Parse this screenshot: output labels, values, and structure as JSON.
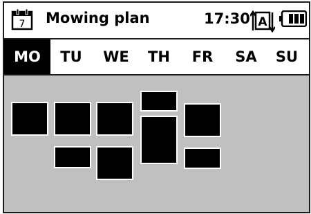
{
  "header": {
    "calendar_day": "7",
    "title": "Mowing plan",
    "time": "17:30",
    "mode_letter": "A",
    "icons": [
      "calendar-icon",
      "auto-mode-icon",
      "battery-icon"
    ]
  },
  "days": [
    {
      "label": "MO",
      "active": true
    },
    {
      "label": "TU",
      "active": false
    },
    {
      "label": "WE",
      "active": false
    },
    {
      "label": "TH",
      "active": false
    },
    {
      "label": "FR",
      "active": false
    },
    {
      "label": "SA",
      "active": false
    },
    {
      "label": "SU",
      "active": false
    }
  ],
  "colors": {
    "plan_background": "#c0c0c0",
    "block": "#000000",
    "active_day_bg": "#000000",
    "active_day_text": "#ffffff"
  }
}
